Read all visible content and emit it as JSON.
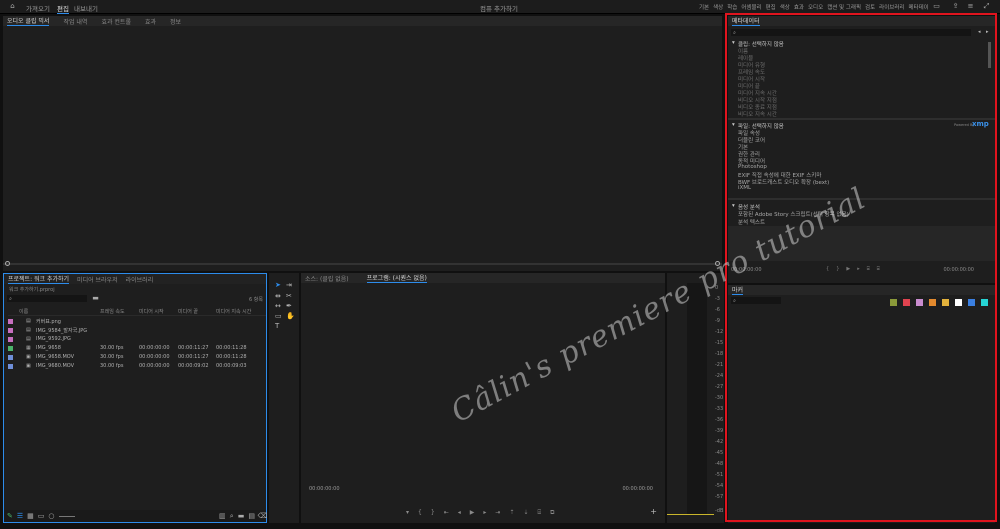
{
  "topbar": {
    "workspaces": [
      "가져오기",
      "편집",
      "내보내기"
    ],
    "active_workspace": "편집",
    "title": "컴퓨 추가하기",
    "right_tabs": [
      "기본",
      "색상",
      "학습",
      "어셈블리",
      "편집",
      "색상",
      "효과",
      "오디오",
      "캡션 및 그래픽",
      "검토",
      "라이브러리",
      "메타데이"
    ]
  },
  "source_panel": {
    "tabs": [
      "오디오 클립 믹서",
      "작업 내역",
      "효과 컨트롤",
      "효과",
      "정보"
    ]
  },
  "project_panel": {
    "tabs": [
      "프로젝트: 워크 추가하기",
      "미디어 브라우저",
      "라이브러리"
    ],
    "breadcrumb": "워크 추가하기.prproj",
    "item_count": "6 항목",
    "columns": [
      "이름",
      "프레임 속도",
      "미디어 시작",
      "미디어 끝",
      "미디어 지속 시간"
    ],
    "rows": [
      {
        "color": "#c86fc0",
        "name": "커버표.png",
        "fps": "",
        "start": "",
        "end": "",
        "dur": ""
      },
      {
        "color": "#c86fc0",
        "name": "IMG_9584_발자국.JPG",
        "fps": "",
        "start": "",
        "end": "",
        "dur": ""
      },
      {
        "color": "#c86fc0",
        "name": "IMG_9592.JPG",
        "fps": "",
        "start": "",
        "end": "",
        "dur": ""
      },
      {
        "color": "#4bb36a",
        "name": "IMG_9658",
        "fps": "30.00 fps",
        "start": "00:00:00:00",
        "end": "00:00:11:27",
        "dur": "00:00:11:28"
      },
      {
        "color": "#6f8fd8",
        "name": "IMG_9658.MOV",
        "fps": "30.00 fps",
        "start": "00:00:00:00",
        "end": "00:00:11:27",
        "dur": "00:00:11:28"
      },
      {
        "color": "#6f8fd8",
        "name": "IMG_9680.MOV",
        "fps": "30.00 fps",
        "start": "00:00:00:00",
        "end": "00:00:09:02",
        "dur": "00:00:09:03"
      }
    ]
  },
  "program_panel": {
    "tabs": [
      "소스: (클립 없음)",
      "프로그램: (시퀀스 없음)"
    ],
    "timecode_left": "00:00:00:00",
    "timecode_right": "00:00:00:00"
  },
  "audio_meter": {
    "scale": [
      "0",
      "-3",
      "-6",
      "-9",
      "-12",
      "-15",
      "-18",
      "-21",
      "-24",
      "-27",
      "-30",
      "-33",
      "-36",
      "-39",
      "-42",
      "-45",
      "-48",
      "-51",
      "-54",
      "-57",
      "-dB"
    ]
  },
  "metadata_panel": {
    "title": "메타데이터",
    "clip_section": "클립: 선택하지 않음",
    "clip_fields": [
      "이름",
      "레이블",
      "미디어 유형",
      "프레임 속도",
      "미디어 시작",
      "미디어 끝",
      "미디어 지속 시간",
      "비디오 시작 지점",
      "비디오 종료 지점",
      "비디오 지속 시간"
    ],
    "file_section": "파일: 선택하지 않음",
    "powered_by": "Powered By",
    "xmp": "xmp",
    "file_fields": [
      "파일 속성",
      "더블린 코어",
      "기본",
      "권한 관리",
      "동적 미디어",
      "Photoshop",
      "EXIF 직접 속성에 대한 EXIF 스키마",
      "BWF 브로드캐스트 오디오 확장 (bext)",
      "iXML"
    ],
    "speech_section": "음성 분석",
    "speech_fields": [
      "포함된 Adobe Story 스크립트(선택 항목 없음)",
      "분석 텍스트"
    ],
    "timecode_left": "00:00:00:00",
    "timecode_right": "00:00:00:00"
  },
  "marker_panel": {
    "title": "마커",
    "colors": [
      "#8b9a3a",
      "#e0434f",
      "#c98ccf",
      "#e38a2e",
      "#e3b23c",
      "#ffffff",
      "#3a7fe0",
      "#26d4d4"
    ]
  },
  "watermark": "Câlin's premiere pro tutorial",
  "accent": "#2d8ceb",
  "highlight_border": "#e0141e"
}
